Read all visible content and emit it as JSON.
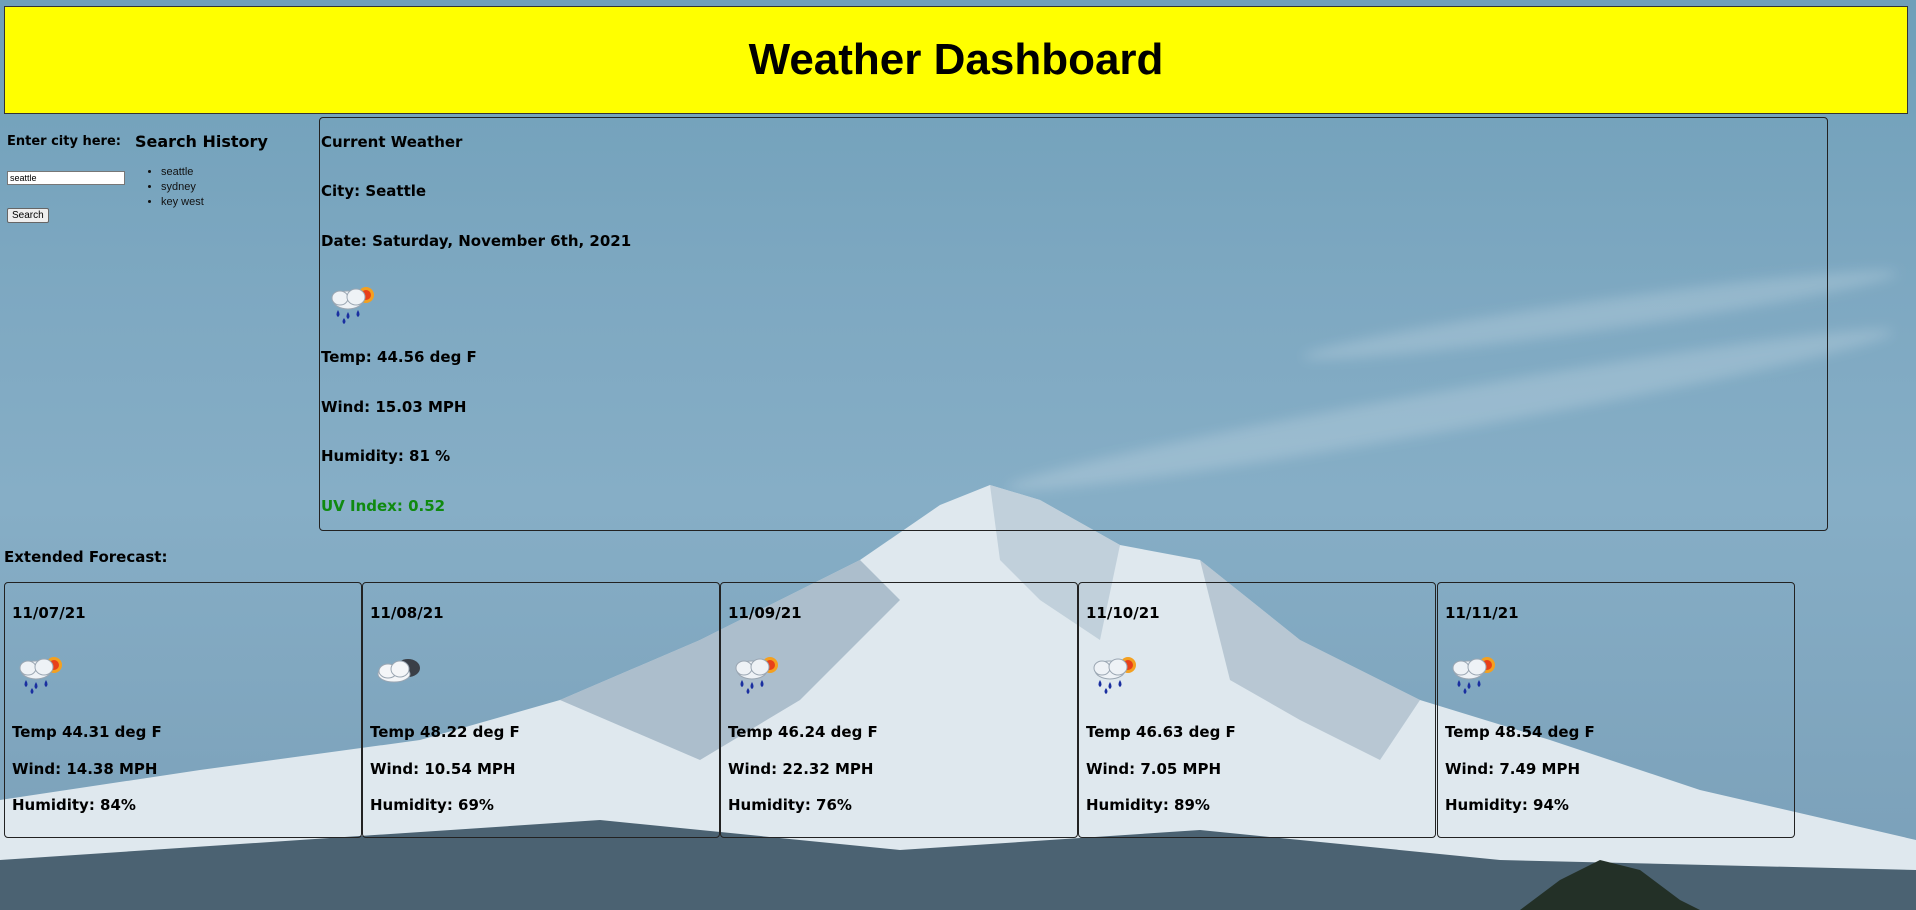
{
  "header": {
    "title": "Weather Dashboard"
  },
  "search": {
    "label": "Enter city here:",
    "value": "seattle",
    "button_label": "Search"
  },
  "history": {
    "title": "Search History",
    "items": [
      "seattle",
      "sydney",
      "key west"
    ]
  },
  "current": {
    "heading": "Current Weather",
    "city": "City: Seattle",
    "date": "Date: Saturday, November 6th, 2021",
    "icon": "rain-sun-icon",
    "temp": "Temp: 44.56 deg F",
    "wind": "Wind: 15.03 MPH",
    "humidity": "Humidity: 81 %",
    "uv": "UV Index: 0.52",
    "uv_color": "#0f8a0f"
  },
  "forecast": {
    "heading": "Extended Forecast:",
    "days": [
      {
        "date": "11/07/21",
        "icon": "rain-sun-icon",
        "temp": "Temp 44.31 deg F",
        "wind": "Wind: 14.38 MPH",
        "humidity": "Humidity: 84%"
      },
      {
        "date": "11/08/21",
        "icon": "cloud-icon",
        "temp": "Temp 48.22 deg F",
        "wind": "Wind: 10.54 MPH",
        "humidity": "Humidity: 69%"
      },
      {
        "date": "11/09/21",
        "icon": "rain-sun-icon",
        "temp": "Temp 46.24 deg F",
        "wind": "Wind: 22.32 MPH",
        "humidity": "Humidity: 76%"
      },
      {
        "date": "11/10/21",
        "icon": "rain-sun-icon",
        "temp": "Temp 46.63 deg F",
        "wind": "Wind: 7.05 MPH",
        "humidity": "Humidity: 89%"
      },
      {
        "date": "11/11/21",
        "icon": "rain-sun-icon",
        "temp": "Temp 48.54 deg F",
        "wind": "Wind: 7.49 MPH",
        "humidity": "Humidity: 94%"
      }
    ]
  },
  "colors": {
    "header_bg": "#ffff00",
    "uv_text": "#0f8a0f"
  }
}
